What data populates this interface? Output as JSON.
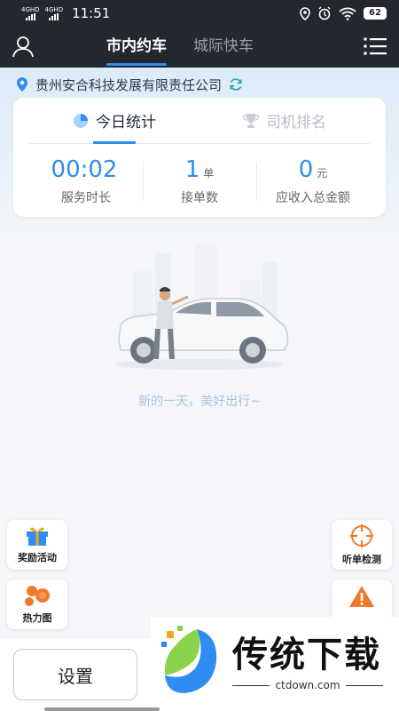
{
  "status_bar": {
    "net1": "4GHD",
    "net2": "4GHD",
    "time": "11:51",
    "battery": "62"
  },
  "nav": {
    "tabs": [
      {
        "label": "市内约车",
        "active": true
      },
      {
        "label": "城际快车",
        "active": false
      }
    ],
    "user_icon": "user-icon",
    "menu_icon": "menu-icon"
  },
  "company": {
    "name": "贵州安合科技发展有限责任公司",
    "pin_icon": "location-pin-icon",
    "refresh_icon": "refresh-icon"
  },
  "stats_card": {
    "tabs": [
      {
        "label": "今日统计",
        "icon": "pie-chart-icon",
        "active": true
      },
      {
        "label": "司机排名",
        "icon": "trophy-icon",
        "active": false
      }
    ],
    "items": [
      {
        "value": "00:02",
        "unit": "",
        "label": "服务时长"
      },
      {
        "value": "1",
        "unit": "单",
        "label": "接单数"
      },
      {
        "value": "0",
        "unit": "元",
        "label": "应收入总金额"
      }
    ]
  },
  "empty_state": {
    "slogan": "新的一天，美好出行~"
  },
  "side_buttons": {
    "reward": {
      "label": "奖励活动",
      "icon": "gift-icon"
    },
    "heatmap": {
      "label": "热力图",
      "icon": "heatmap-icon"
    },
    "listen_check": {
      "label": "听单检测",
      "icon": "target-icon"
    },
    "warning": {
      "icon": "warning-icon"
    }
  },
  "bottom": {
    "settings_label": "设置"
  },
  "watermark": {
    "title": "传统下载",
    "url": "ctdown.com"
  },
  "colors": {
    "accent": "#2f8cf0",
    "dark_bar": "#23272e",
    "orange": "#f07a2a"
  }
}
